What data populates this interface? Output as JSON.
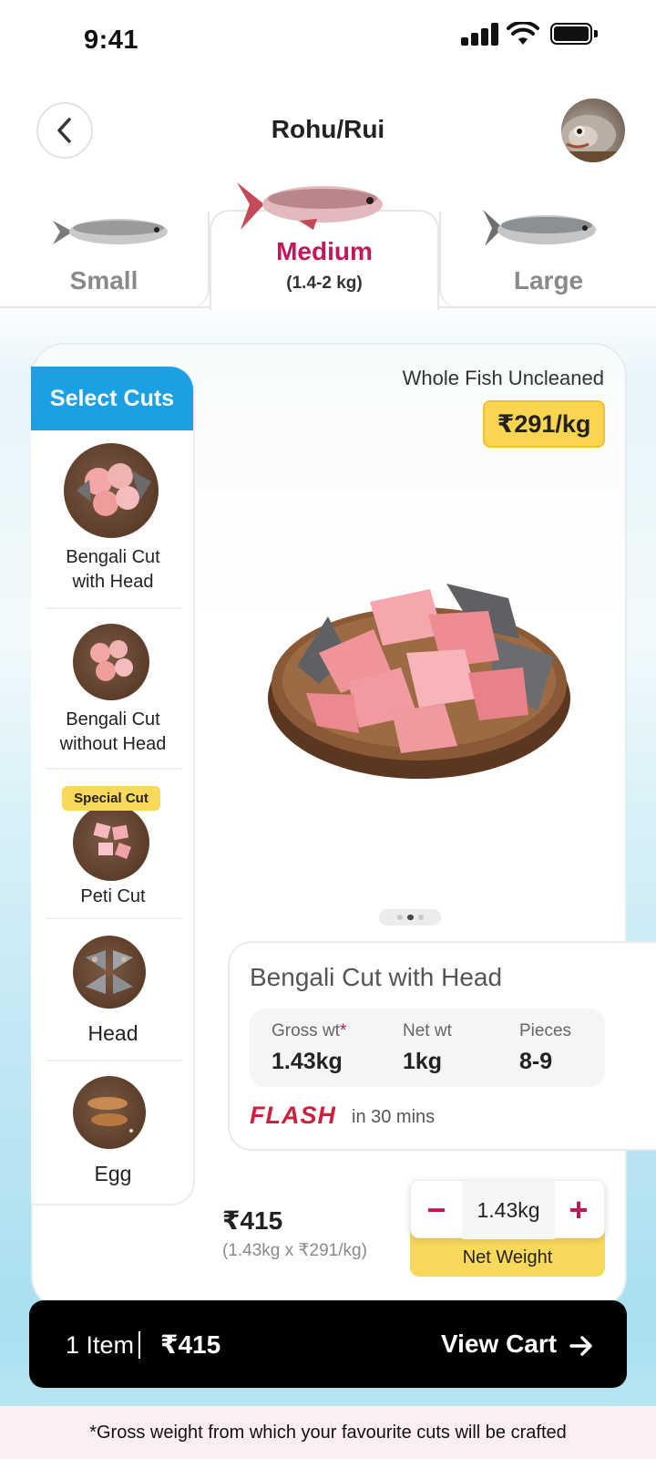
{
  "status_bar": {
    "time": "9:41"
  },
  "header": {
    "title": "Rohu/Rui"
  },
  "sizes": [
    {
      "label": "Small",
      "sub": ""
    },
    {
      "label": "Medium",
      "sub": "(1.4-2 kg)"
    },
    {
      "label": "Large",
      "sub": ""
    }
  ],
  "selected_size": "Medium",
  "cuts": {
    "header": "Select Cuts",
    "items": [
      {
        "name_line1": "Bengali Cut",
        "name_line2": "with Head",
        "badge": ""
      },
      {
        "name_line1": "Bengali Cut",
        "name_line2": "without Head",
        "badge": ""
      },
      {
        "name_line1": "Peti Cut",
        "name_line2": "",
        "badge": "Special Cut"
      },
      {
        "name_line1": "Head",
        "name_line2": "",
        "badge": ""
      },
      {
        "name_line1": "Egg",
        "name_line2": "",
        "badge": ""
      }
    ]
  },
  "product": {
    "variant": "Whole Fish Uncleaned",
    "rate": "₹291/kg",
    "carousel": {
      "count": 3,
      "active": 1
    }
  },
  "details": {
    "title": "Bengali Cut with Head",
    "gross_label": "Gross wt",
    "gross_star": "*",
    "gross_value": "1.43kg",
    "net_label": "Net wt",
    "net_value": "1kg",
    "pieces_label": "Pieces",
    "pieces_value": "8-9",
    "flash_brand": "FLASH",
    "flash_time": "in 30 mins"
  },
  "pricing": {
    "total": "₹415",
    "breakdown": "(1.43kg x ₹291/kg)",
    "stepper_minus": "−",
    "stepper_plus": "+",
    "quantity": "1.43kg",
    "quantity_label": "Net Weight"
  },
  "cart": {
    "count": "1 Item",
    "total": "₹415",
    "cta": "View Cart"
  },
  "footnote": "*Gross weight from which your favourite cuts will be crafted",
  "colors": {
    "accent": "#c2185b",
    "cuts_header": "#1aa0e3",
    "price_chip": "#fbd54f",
    "cart_bar": "#000000"
  },
  "icons": [
    "back-arrow-icon",
    "signal-icon",
    "wifi-icon",
    "battery-icon",
    "arrow-right-icon",
    "minus-icon",
    "plus-icon"
  ]
}
